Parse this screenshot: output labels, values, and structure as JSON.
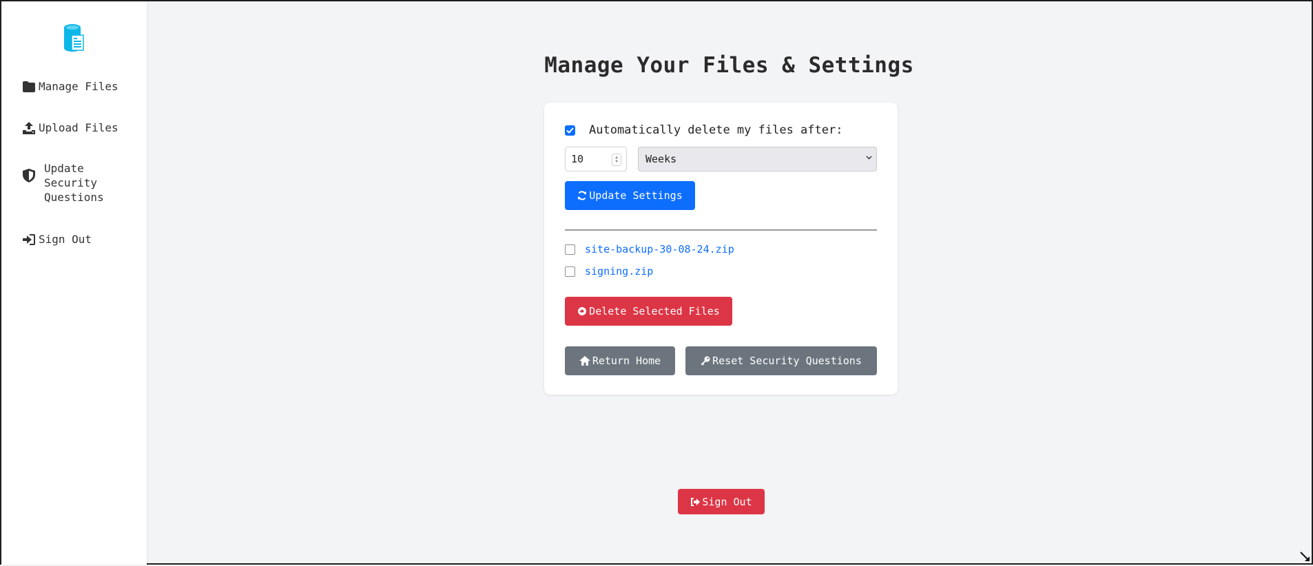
{
  "sidebar": {
    "logo_icon": "file-database-icon",
    "items": [
      {
        "label": "Manage Files",
        "icon": "folder-icon"
      },
      {
        "label": "Upload Files",
        "icon": "upload-icon"
      },
      {
        "label": "Update\nSecurity\nQuestions",
        "icon": "shield-icon"
      },
      {
        "label": "Sign Out",
        "icon": "sign-in-icon"
      }
    ]
  },
  "main": {
    "title": "Manage Your Files & Settings"
  },
  "settings": {
    "auto_delete_label": "Automatically delete my files after:",
    "auto_delete_checked": true,
    "amount_value": "10",
    "unit_selected": "Weeks",
    "update_button": "Update Settings"
  },
  "files": [
    {
      "name": "site-backup-30-08-24.zip",
      "checked": false
    },
    {
      "name": "signing.zip",
      "checked": false
    }
  ],
  "actions": {
    "delete_button": "Delete Selected Files",
    "return_home_button": "Return Home",
    "reset_security_button": "Reset Security Questions",
    "sign_out_button": "Sign Out"
  },
  "colors": {
    "primary": "#0d6efd",
    "danger": "#dc3545",
    "secondary": "#6c757d",
    "logo": "#0db7e8",
    "background": "#f3f4f6"
  }
}
